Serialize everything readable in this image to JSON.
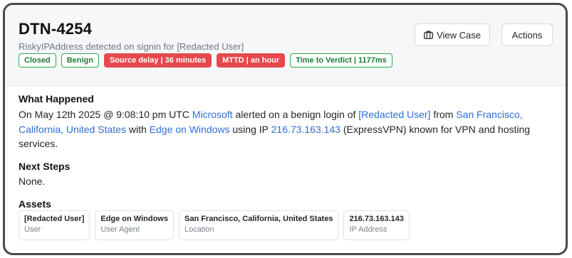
{
  "header": {
    "title": "DTN-4254",
    "subtitle": "RiskyIPAddress detected on signin for [Redacted User]",
    "badges": [
      {
        "label": "Closed",
        "style": "outline",
        "color": "#2fa84f"
      },
      {
        "label": "Benign",
        "style": "outline",
        "color": "#2fa84f"
      },
      {
        "label": "Source delay | 36 minutes",
        "style": "solid",
        "color": "#e5484d"
      },
      {
        "label": "MTTD | an hour",
        "style": "solid",
        "color": "#e5484d"
      },
      {
        "label": "Time to Verdict | 1177ms",
        "style": "outline",
        "color": "#2fa84f"
      }
    ],
    "view_case_label": "View Case",
    "view_case_icon": "briefcase-icon",
    "actions_label": "Actions"
  },
  "what_happened": {
    "title": "What Happened",
    "p1": "On May 12th 2025 @ 9:08:10 pm UTC ",
    "vendor": "Microsoft",
    "p2": " alerted on a benign login of ",
    "user": "[Redacted User]",
    "p3": " from ",
    "location": "San Francisco, California, United States",
    "p4": " with ",
    "agent": "Edge on Windows",
    "p5": " using IP ",
    "ip": "216.73.163.143",
    "p6": " (ExpressVPN) known for VPN and hosting services."
  },
  "next_steps": {
    "title": "Next Steps",
    "text": "None."
  },
  "assets": {
    "title": "Assets",
    "items": [
      {
        "value": "[Redacted User]",
        "label": "User"
      },
      {
        "value": "Edge on Windows",
        "label": "User Agent"
      },
      {
        "value": "San Francisco, California, United States",
        "label": "Location"
      },
      {
        "value": "216.73.163.143",
        "label": "IP Address"
      }
    ]
  },
  "colors": {
    "link": "#2f6fd6",
    "success": "#2fa84f",
    "danger": "#e5484d"
  }
}
